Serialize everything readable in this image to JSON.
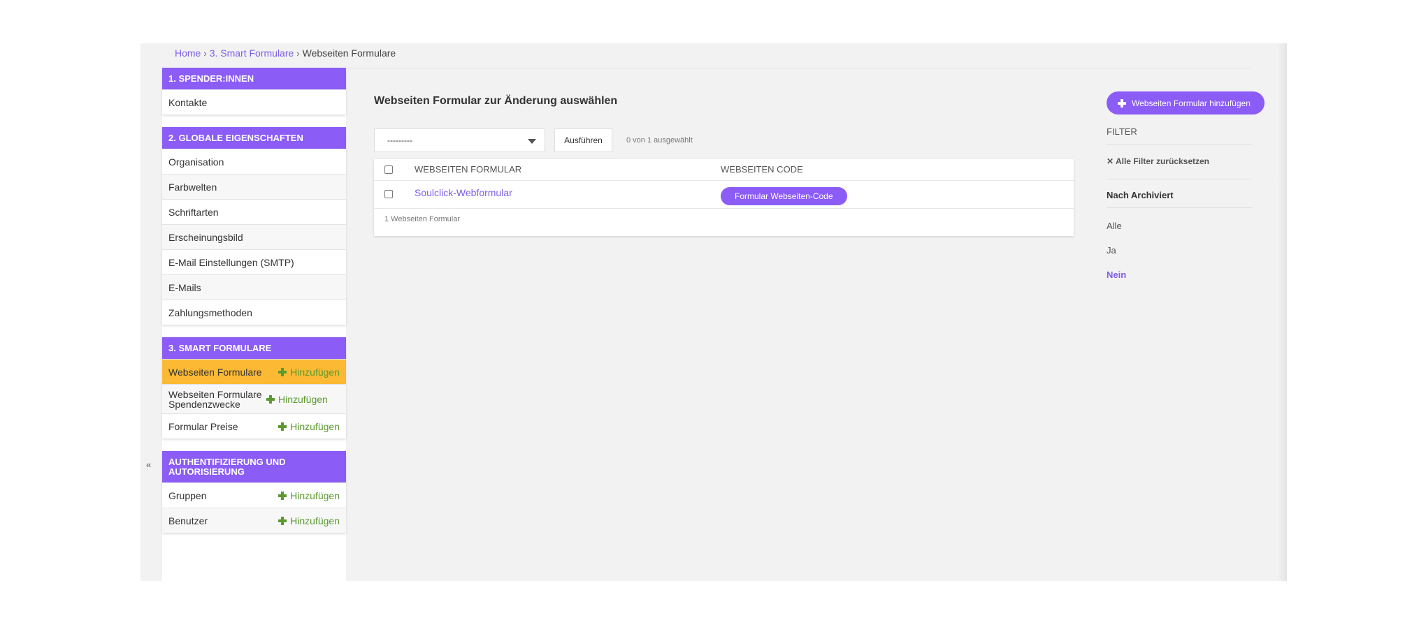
{
  "breadcrumbs": {
    "home": "Home",
    "section": "3. Smart Formulare",
    "current": "Webseiten Formulare",
    "separator": "›"
  },
  "sidebar": {
    "collapse_label": "«",
    "add_label": "Hinzufügen",
    "modules": [
      {
        "title": "1. Spender:innen",
        "items": [
          {
            "label": "Kontakte"
          }
        ]
      },
      {
        "title": "2. Globale Eigenschaften",
        "items": [
          {
            "label": "Organisation"
          },
          {
            "label": "Farbwelten"
          },
          {
            "label": "Schriftarten"
          },
          {
            "label": "Erscheinungsbild"
          },
          {
            "label": "E-Mail Einstellungen (SMTP)"
          },
          {
            "label": "E-Mails"
          },
          {
            "label": "Zahlungsmethoden"
          }
        ]
      },
      {
        "title": "3. Smart Formulare",
        "items": [
          {
            "label": "Webseiten Formulare",
            "active": true
          },
          {
            "label": "Webseiten Formulare Spendenzwecke"
          },
          {
            "label": "Formular Preise"
          }
        ]
      },
      {
        "title": "Authentifizierung und Autorisierung",
        "items": [
          {
            "label": "Gruppen"
          },
          {
            "label": "Benutzer"
          }
        ]
      }
    ]
  },
  "content": {
    "title": "Webseiten Formular zur Änderung auswählen",
    "add_button": "Webseiten Formular hinzufügen",
    "action_select_value": "---------",
    "run_button": "Ausführen",
    "selection_count": "0 von 1 ausgewählt",
    "table": {
      "columns": [
        "Webseiten Formular",
        "Webseiten Code"
      ],
      "rows": [
        {
          "name": "Soulclick-Webformular",
          "code_button": "Formular Webseiten-Code"
        }
      ],
      "footer": "1 Webseiten Formular"
    }
  },
  "filter": {
    "title": "Filter",
    "clear": "Alle Filter zurücksetzen",
    "group_title": "Nach Archiviert",
    "options": [
      "Alle",
      "Ja",
      "Nein"
    ],
    "selected": "Nein"
  },
  "colors": {
    "accent": "#8b5cf6",
    "link": "#7e5ee8",
    "active_row": "#fbb934",
    "add_green": "#5b9a2f"
  }
}
